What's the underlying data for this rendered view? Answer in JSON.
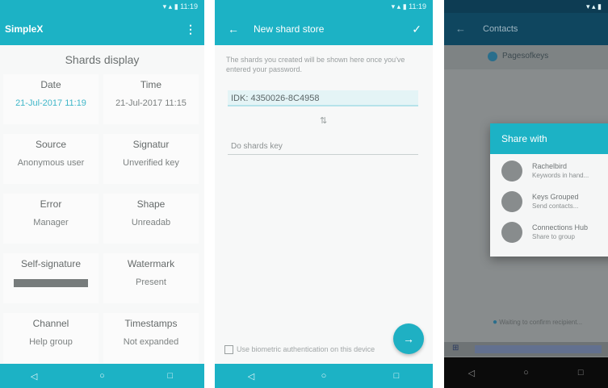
{
  "panel1": {
    "app_title": "SimpleX",
    "section_title": "Shards display",
    "cells": [
      {
        "label": "Date",
        "value": "21-Jul-2017 11:19",
        "accent": true,
        "bar": false
      },
      {
        "label": "Time",
        "value": "21-Jul-2017 11:15",
        "accent": false,
        "bar": false
      },
      {
        "label": "Source",
        "value": "Anonymous user",
        "accent": false,
        "bar": false
      },
      {
        "label": "Signatur",
        "value": "Unverified key",
        "accent": false,
        "bar": false
      },
      {
        "label": "Error",
        "value": "Manager",
        "accent": false,
        "bar": false
      },
      {
        "label": "Shape",
        "value": "Unreadab",
        "accent": false,
        "bar": false
      },
      {
        "label": "Self-signature",
        "value": "",
        "accent": false,
        "bar": true
      },
      {
        "label": "Watermark",
        "value": "Present",
        "accent": false,
        "bar": false
      },
      {
        "label": "Channel",
        "value": "Help group",
        "accent": false,
        "bar": false
      },
      {
        "label": "Timestamps",
        "value": "Not expanded",
        "accent": false,
        "bar": false
      }
    ],
    "nav": [
      "◁",
      "○",
      "□"
    ]
  },
  "panel2": {
    "title": "New shard store",
    "hint": "The shards you created will be shown here once you've entered your password.",
    "input_value": "IDK: 4350026-8C4958",
    "swap_icon": "⇅",
    "second_input": "Do shards key",
    "checkbox_label": "Use biometric authentication on this device",
    "fab_icon": "→",
    "nav": [
      "◁",
      "○",
      "□"
    ]
  },
  "panel3": {
    "title": "Contacts",
    "chat_name": "Pagesofkeys",
    "dialog_title": "Share with",
    "items": [
      {
        "line1": "Rachelbird",
        "line2": "Keywords in hand..."
      },
      {
        "line1": "Keys Grouped",
        "line2": "Send contacts..."
      },
      {
        "line1": "Connections Hub",
        "line2": "Share to group"
      }
    ],
    "footnote": "Waiting to confirm recipient...",
    "nav": [
      "◁",
      "○",
      "□"
    ]
  },
  "colors": {
    "accent": "#1cb2c5",
    "dark_appbar": "#0f465f",
    "scrim": "#888c8d"
  }
}
